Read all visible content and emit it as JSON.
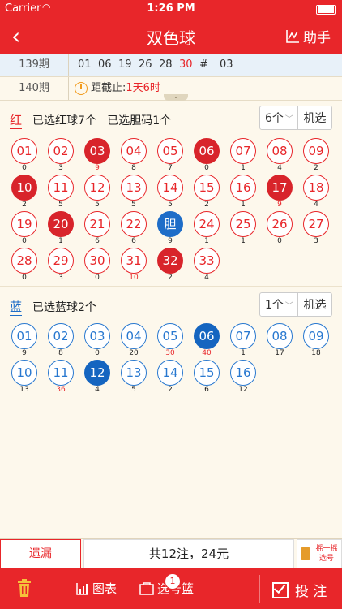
{
  "status": {
    "carrier": "Carrier",
    "time": "1:26 PM"
  },
  "nav": {
    "back": "‹",
    "title": "双色球",
    "helper": "助手"
  },
  "history": {
    "p139": {
      "label": "139期",
      "numbers": [
        "01",
        "06",
        "19",
        "26",
        "28",
        "30",
        "#",
        "03"
      ]
    },
    "p140": {
      "label": "140期",
      "deadline_label": "距截止:",
      "deadline_value": "1天6时"
    }
  },
  "red_section": {
    "tag": "红",
    "selected_text": "已选红球7个",
    "dan_text": "已选胆码1个",
    "count": "6个",
    "random": "机选",
    "balls": [
      {
        "n": "01",
        "miss": "0",
        "sel": false
      },
      {
        "n": "02",
        "miss": "3",
        "sel": false
      },
      {
        "n": "03",
        "miss": "9",
        "sel": true,
        "hot": true
      },
      {
        "n": "04",
        "miss": "8",
        "sel": false
      },
      {
        "n": "05",
        "miss": "7",
        "sel": false
      },
      {
        "n": "06",
        "miss": "0",
        "sel": true
      },
      {
        "n": "07",
        "miss": "1",
        "sel": false
      },
      {
        "n": "08",
        "miss": "4",
        "sel": false
      },
      {
        "n": "09",
        "miss": "2",
        "sel": false
      },
      {
        "n": "10",
        "miss": "2",
        "sel": true
      },
      {
        "n": "11",
        "miss": "5",
        "sel": false
      },
      {
        "n": "12",
        "miss": "5",
        "sel": false
      },
      {
        "n": "13",
        "miss": "5",
        "sel": false
      },
      {
        "n": "14",
        "miss": "5",
        "sel": false
      },
      {
        "n": "15",
        "miss": "2",
        "sel": false
      },
      {
        "n": "16",
        "miss": "1",
        "sel": false
      },
      {
        "n": "17",
        "miss": "9",
        "sel": true,
        "hot": true
      },
      {
        "n": "18",
        "miss": "4",
        "sel": false
      },
      {
        "n": "19",
        "miss": "0",
        "sel": false
      },
      {
        "n": "20",
        "miss": "1",
        "sel": true
      },
      {
        "n": "21",
        "miss": "6",
        "sel": false
      },
      {
        "n": "22",
        "miss": "6",
        "sel": false
      },
      {
        "n": "胆",
        "miss": "9",
        "dan": true
      },
      {
        "n": "24",
        "miss": "1",
        "sel": false
      },
      {
        "n": "25",
        "miss": "1",
        "sel": false
      },
      {
        "n": "26",
        "miss": "0",
        "sel": false
      },
      {
        "n": "27",
        "miss": "3",
        "sel": false
      },
      {
        "n": "28",
        "miss": "0",
        "sel": false
      },
      {
        "n": "29",
        "miss": "3",
        "sel": false
      },
      {
        "n": "30",
        "miss": "0",
        "sel": false
      },
      {
        "n": "31",
        "miss": "10",
        "sel": false,
        "hot": true
      },
      {
        "n": "32",
        "miss": "2",
        "sel": true
      },
      {
        "n": "33",
        "miss": "4",
        "sel": false
      }
    ]
  },
  "blue_section": {
    "tag": "蓝",
    "selected_text": "已选蓝球2个",
    "count": "1个",
    "random": "机选",
    "balls": [
      {
        "n": "01",
        "miss": "9",
        "sel": false
      },
      {
        "n": "02",
        "miss": "8",
        "sel": false
      },
      {
        "n": "03",
        "miss": "0",
        "sel": false
      },
      {
        "n": "04",
        "miss": "20",
        "sel": false
      },
      {
        "n": "05",
        "miss": "30",
        "sel": false,
        "hot": true
      },
      {
        "n": "06",
        "miss": "40",
        "sel": true,
        "hot": true
      },
      {
        "n": "07",
        "miss": "1",
        "sel": false
      },
      {
        "n": "08",
        "miss": "17",
        "sel": false
      },
      {
        "n": "09",
        "miss": "18",
        "sel": false
      },
      {
        "n": "10",
        "miss": "13",
        "sel": false
      },
      {
        "n": "11",
        "miss": "36",
        "sel": false,
        "hot": true
      },
      {
        "n": "12",
        "miss": "4",
        "sel": true
      },
      {
        "n": "13",
        "miss": "5",
        "sel": false
      },
      {
        "n": "14",
        "miss": "2",
        "sel": false
      },
      {
        "n": "15",
        "miss": "6",
        "sel": false
      },
      {
        "n": "16",
        "miss": "12",
        "sel": false
      }
    ]
  },
  "summary": {
    "miss_button": "遗漏",
    "total": "共12注，24元",
    "shake_line1": "摇一摇",
    "shake_line2": "选号"
  },
  "tabbar": {
    "chart": "图表",
    "picked": "选号篮",
    "badge": "1",
    "bet": "投 注"
  },
  "colors": {
    "accent": "#e8262a",
    "blue": "#1e6dc8"
  }
}
